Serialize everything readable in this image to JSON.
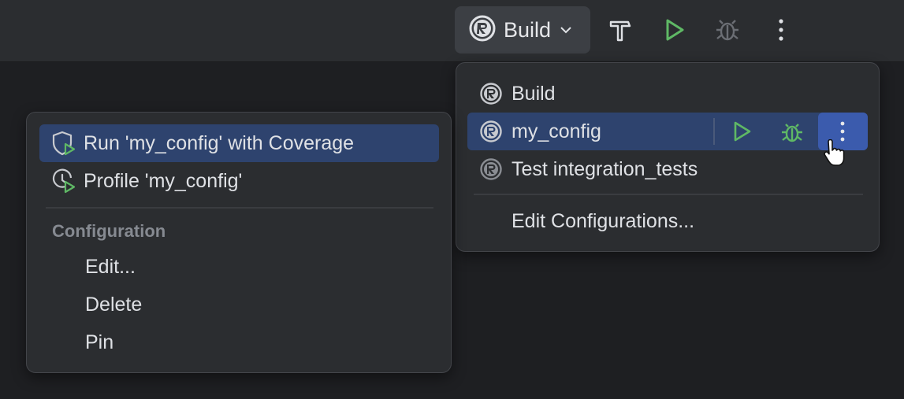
{
  "toolbar": {
    "config_label": "Build",
    "icons": [
      "rust-icon",
      "chevron-down-icon",
      "hammer-icon",
      "run-icon",
      "debug-icon",
      "more-vertical-icon"
    ]
  },
  "run_popup": {
    "items": [
      {
        "label": "Build",
        "icon": "rust-icon"
      },
      {
        "label": "my_config",
        "icon": "rust-icon"
      },
      {
        "label": "Test integration_tests",
        "icon": "rust-test-icon"
      }
    ],
    "edit_label": "Edit Configurations..."
  },
  "config_submenu": {
    "run_coverage": "Run 'my_config' with Coverage",
    "profile": "Profile 'my_config'",
    "section_title": "Configuration",
    "edit": "Edit...",
    "delete": "Delete",
    "pin": "Pin"
  },
  "colors": {
    "toolbar_bg": "#2b2d30",
    "popup_bg": "#2b2d30",
    "selection": "#2e436e",
    "run_green": "#5fb865"
  }
}
